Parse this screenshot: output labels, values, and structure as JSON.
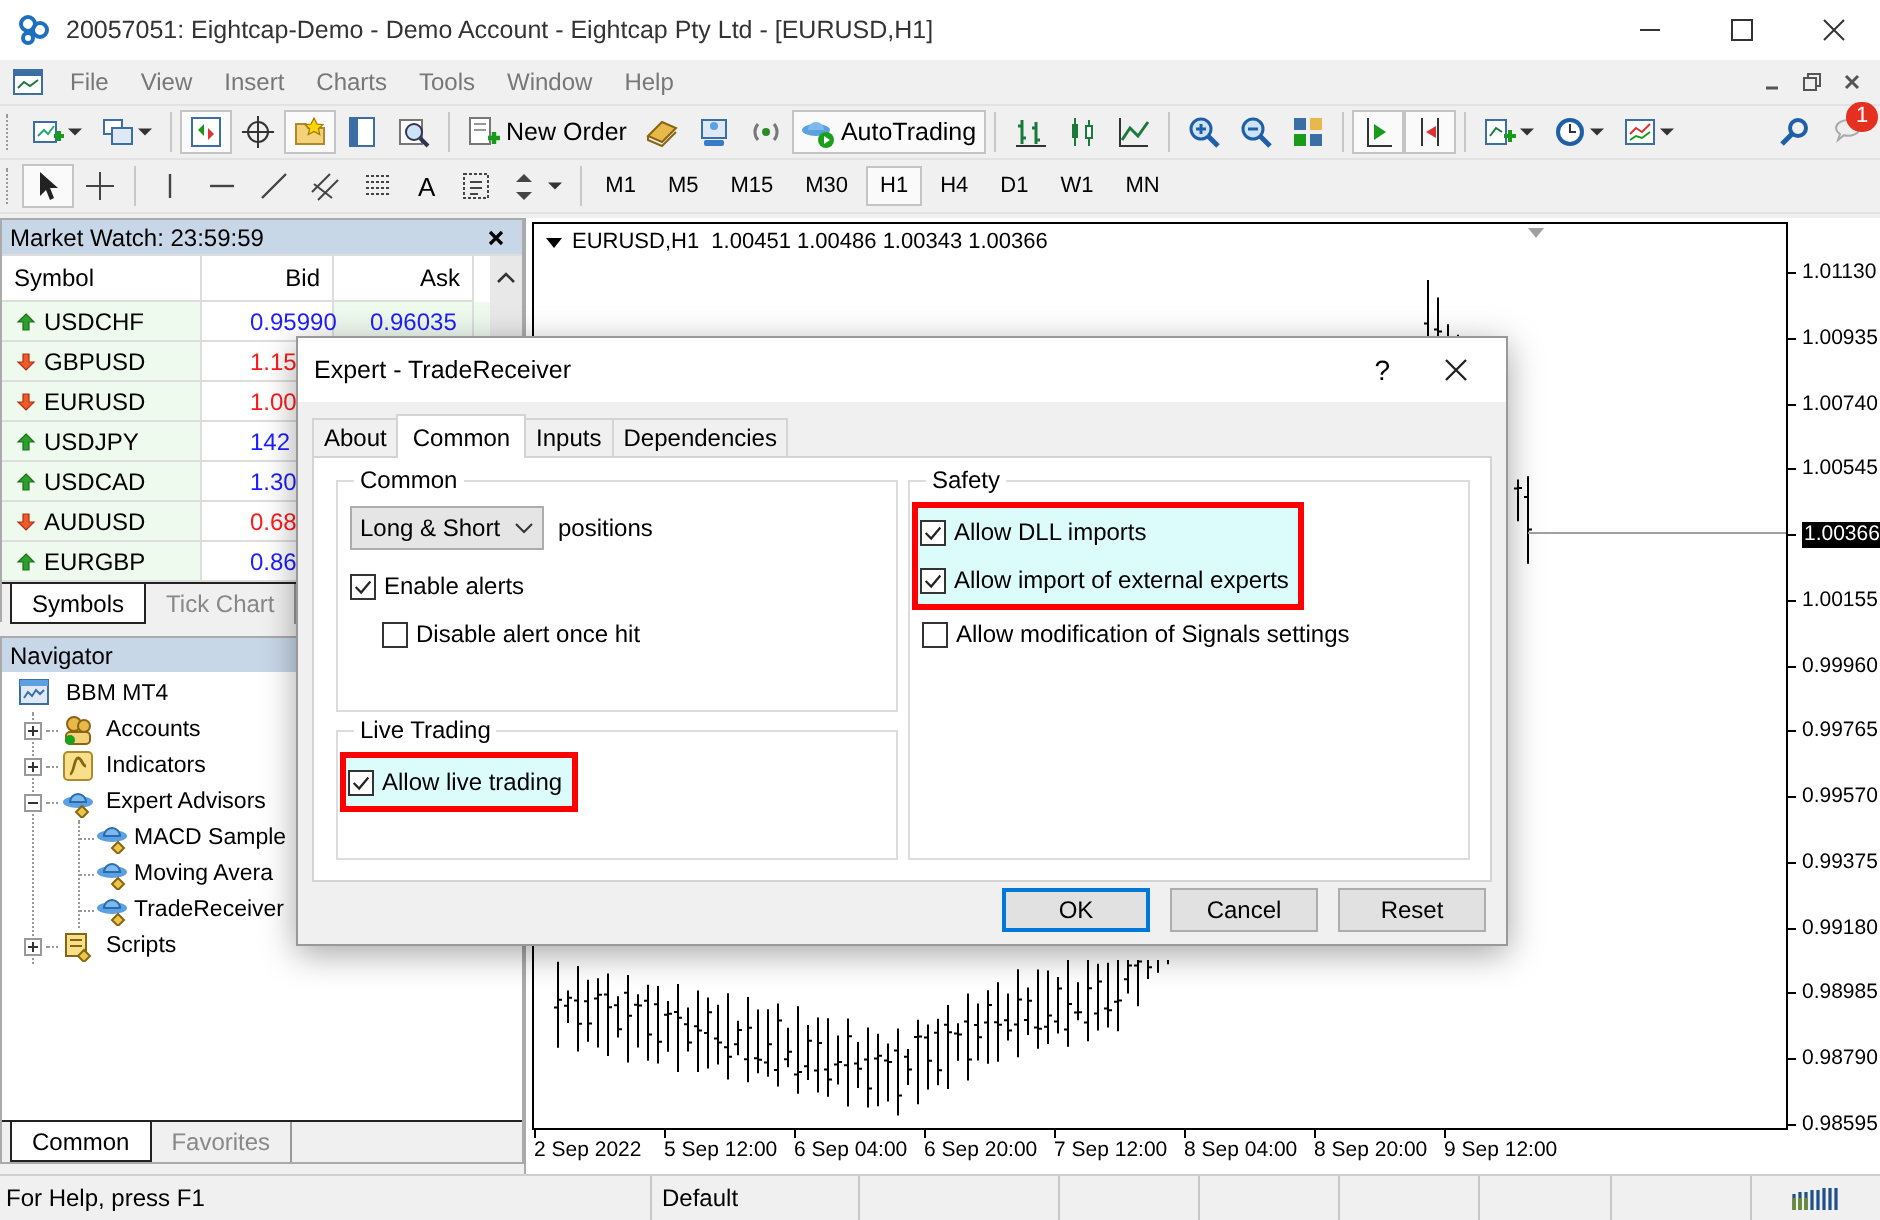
{
  "window": {
    "title": "20057051: Eightcap-Demo - Demo Account - Eightcap Pty Ltd - [EURUSD,H1]"
  },
  "menu": [
    "File",
    "View",
    "Insert",
    "Charts",
    "Tools",
    "Window",
    "Help"
  ],
  "toolbar": {
    "new_order": "New Order",
    "autotrading": "AutoTrading",
    "notification_count": "1"
  },
  "drawing_toolbar": {
    "text_tool": "A"
  },
  "timeframes": [
    {
      "label": "M1",
      "selected": false
    },
    {
      "label": "M5",
      "selected": false
    },
    {
      "label": "M15",
      "selected": false
    },
    {
      "label": "M30",
      "selected": false
    },
    {
      "label": "H1",
      "selected": true
    },
    {
      "label": "H4",
      "selected": false
    },
    {
      "label": "D1",
      "selected": false
    },
    {
      "label": "W1",
      "selected": false
    },
    {
      "label": "MN",
      "selected": false
    }
  ],
  "market_watch": {
    "title": "Market Watch: 23:59:59",
    "columns": [
      "Symbol",
      "Bid",
      "Ask"
    ],
    "rows": [
      {
        "symbol": "USDCHF",
        "kind": "up",
        "bid": "0.95990",
        "ask": "0.96035"
      },
      {
        "symbol": "GBPUSD",
        "kind": "down",
        "bid": "1.15"
      },
      {
        "symbol": "EURUSD",
        "kind": "down",
        "bid": "1.00"
      },
      {
        "symbol": "USDJPY",
        "kind": "up",
        "bid": "142"
      },
      {
        "symbol": "USDCAD",
        "kind": "up",
        "bid": "1.30"
      },
      {
        "symbol": "AUDUSD",
        "kind": "down",
        "bid": "0.68"
      },
      {
        "symbol": "EURGBP",
        "kind": "up",
        "bid": "0.86"
      }
    ],
    "tabs": [
      {
        "label": "Symbols",
        "selected": true
      },
      {
        "label": "Tick Chart",
        "selected": false
      }
    ]
  },
  "navigator": {
    "title": "Navigator",
    "root": "BBM MT4",
    "items": [
      {
        "label": "Accounts",
        "kind": "accounts",
        "expanded": false
      },
      {
        "label": "Indicators",
        "kind": "indicators",
        "expanded": false
      },
      {
        "label": "Expert Advisors",
        "kind": "experts",
        "expanded": true,
        "children": [
          {
            "label": "MACD Sample"
          },
          {
            "label": "Moving Avera"
          },
          {
            "label": "TradeReceiver"
          }
        ]
      },
      {
        "label": "Scripts",
        "kind": "scripts",
        "expanded": false
      }
    ],
    "tabs": [
      {
        "label": "Common",
        "selected": true
      },
      {
        "label": "Favorites",
        "selected": false
      }
    ]
  },
  "chart": {
    "header": "EURUSD,H1  1.00451 1.00486 1.00343 1.00366",
    "price_axis": [
      {
        "label": "1.01130",
        "kind": "tick"
      },
      {
        "label": "1.00935",
        "kind": "tick"
      },
      {
        "label": "1.00740",
        "kind": "tick"
      },
      {
        "label": "1.00545",
        "kind": "tick"
      },
      {
        "label": "1.00366",
        "kind": "current"
      },
      {
        "label": "1.00155",
        "kind": "tick"
      },
      {
        "label": "0.99960",
        "kind": "tick"
      },
      {
        "label": "0.99765",
        "kind": "tick"
      },
      {
        "label": "0.99570",
        "kind": "tick"
      },
      {
        "label": "0.99375",
        "kind": "tick"
      },
      {
        "label": "0.99180",
        "kind": "tick"
      },
      {
        "label": "0.98985",
        "kind": "tick"
      },
      {
        "label": "0.98790",
        "kind": "tick"
      },
      {
        "label": "0.98595",
        "kind": "tick"
      }
    ],
    "time_axis": [
      "2 Sep 2022",
      "5 Sep 12:00",
      "6 Sep 04:00",
      "6 Sep 20:00",
      "7 Sep 12:00",
      "8 Sep 04:00",
      "8 Sep 20:00",
      "9 Sep 12:00"
    ]
  },
  "dialog": {
    "title": "Expert - TradeReceiver",
    "help": "?",
    "tabs": [
      {
        "label": "About",
        "selected": false
      },
      {
        "label": "Common",
        "selected": true
      },
      {
        "label": "Inputs",
        "selected": false
      },
      {
        "label": "Dependencies",
        "selected": false
      }
    ],
    "left_groups": [
      {
        "title": "Common",
        "rows": [
          {
            "kind": "select",
            "value": "Long & Short",
            "label": "positions"
          },
          {
            "kind": "checkbox",
            "label": "Enable alerts",
            "checked": true
          },
          {
            "kind": "sub_checkbox",
            "label": "Disable alert once hit",
            "checked": false
          }
        ]
      },
      {
        "title": "Live Trading",
        "rows": [
          {
            "kind": "highlight",
            "options": [
              {
                "label": "Allow live trading",
                "checked": true
              }
            ]
          }
        ]
      }
    ],
    "right_groups": [
      {
        "title": "Safety",
        "rows": [
          {
            "kind": "highlight",
            "options": [
              {
                "label": "Allow DLL imports",
                "checked": true
              },
              {
                "label": "Allow import of external experts",
                "checked": true
              }
            ]
          },
          {
            "kind": "checkbox",
            "label": "Allow modification of Signals settings",
            "checked": false
          }
        ]
      }
    ],
    "buttons": [
      {
        "label": "OK",
        "default": true
      },
      {
        "label": "Cancel",
        "default": false
      },
      {
        "label": "Reset",
        "default": false
      }
    ]
  },
  "status_bar": {
    "help": "For Help, press F1",
    "profile": "Default"
  }
}
